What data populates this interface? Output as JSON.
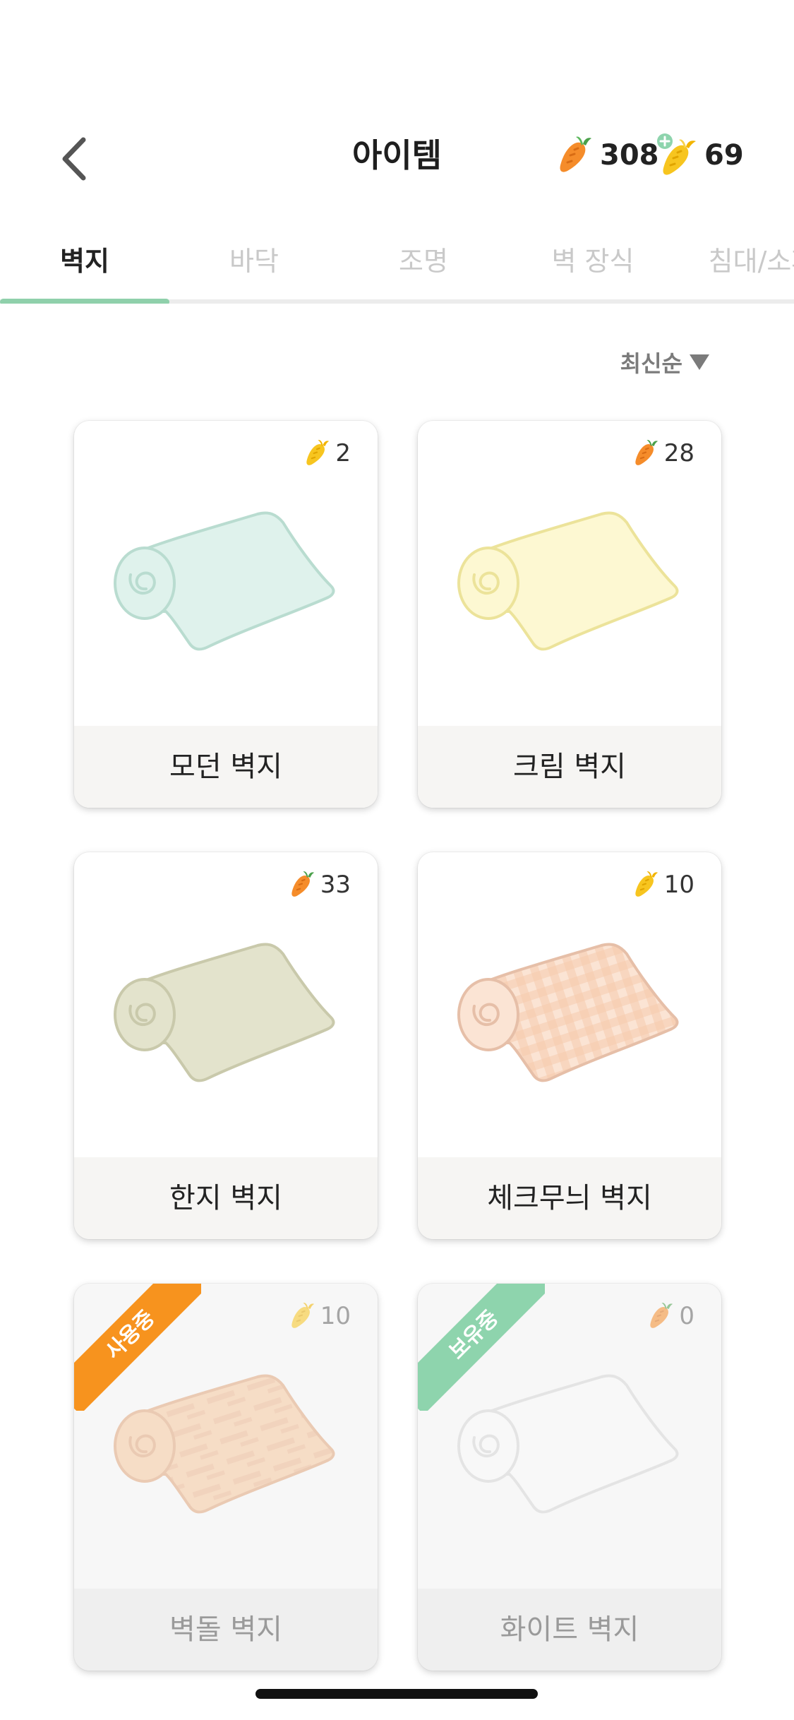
{
  "header": {
    "title": "아이템",
    "back_icon": "chevron-left-icon",
    "carrot_count": "308",
    "gold_count": "69",
    "carrot_icon": "carrot-icon",
    "gold_icon": "gold-carrot-icon"
  },
  "tabs": [
    {
      "label": "벽지",
      "active": true
    },
    {
      "label": "바닥",
      "active": false
    },
    {
      "label": "조명",
      "active": false
    },
    {
      "label": "벽 장식",
      "active": false
    },
    {
      "label": "침대/소파",
      "active": false
    }
  ],
  "sort": {
    "label": "최신순"
  },
  "items": [
    {
      "name": "모던 벽지",
      "price": "2",
      "currency": "gold",
      "color": "#dff2ec",
      "stroke": "#b9dcd0",
      "pattern": "plain",
      "status": ""
    },
    {
      "name": "크림 벽지",
      "price": "28",
      "currency": "carrot",
      "color": "#fdf8d2",
      "stroke": "#ece39a",
      "pattern": "plain",
      "status": ""
    },
    {
      "name": "한지 벽지",
      "price": "33",
      "currency": "carrot",
      "color": "#e3e3cc",
      "stroke": "#c9c9ab",
      "pattern": "plain",
      "status": ""
    },
    {
      "name": "체크무늬 벽지",
      "price": "10",
      "currency": "gold",
      "color": "#fbe4d4",
      "stroke": "#e6bfa8",
      "pattern": "check",
      "status": ""
    },
    {
      "name": "벽돌 벽지",
      "price": "10",
      "currency": "gold",
      "color": "#f6c89f",
      "stroke": "#e0a77d",
      "pattern": "brick",
      "status": "사용중"
    },
    {
      "name": "화이트 벽지",
      "price": "0",
      "currency": "carrot",
      "color": "#fafafa",
      "stroke": "#d6d6d6",
      "pattern": "plain",
      "status": "보유중"
    }
  ],
  "colors": {
    "accent": "#8fd0ab",
    "in_use_ribbon": "#f7931e",
    "owned_ribbon": "#8ed4ad",
    "carrot": "#f58c2a",
    "gold": "#f7c51f"
  }
}
